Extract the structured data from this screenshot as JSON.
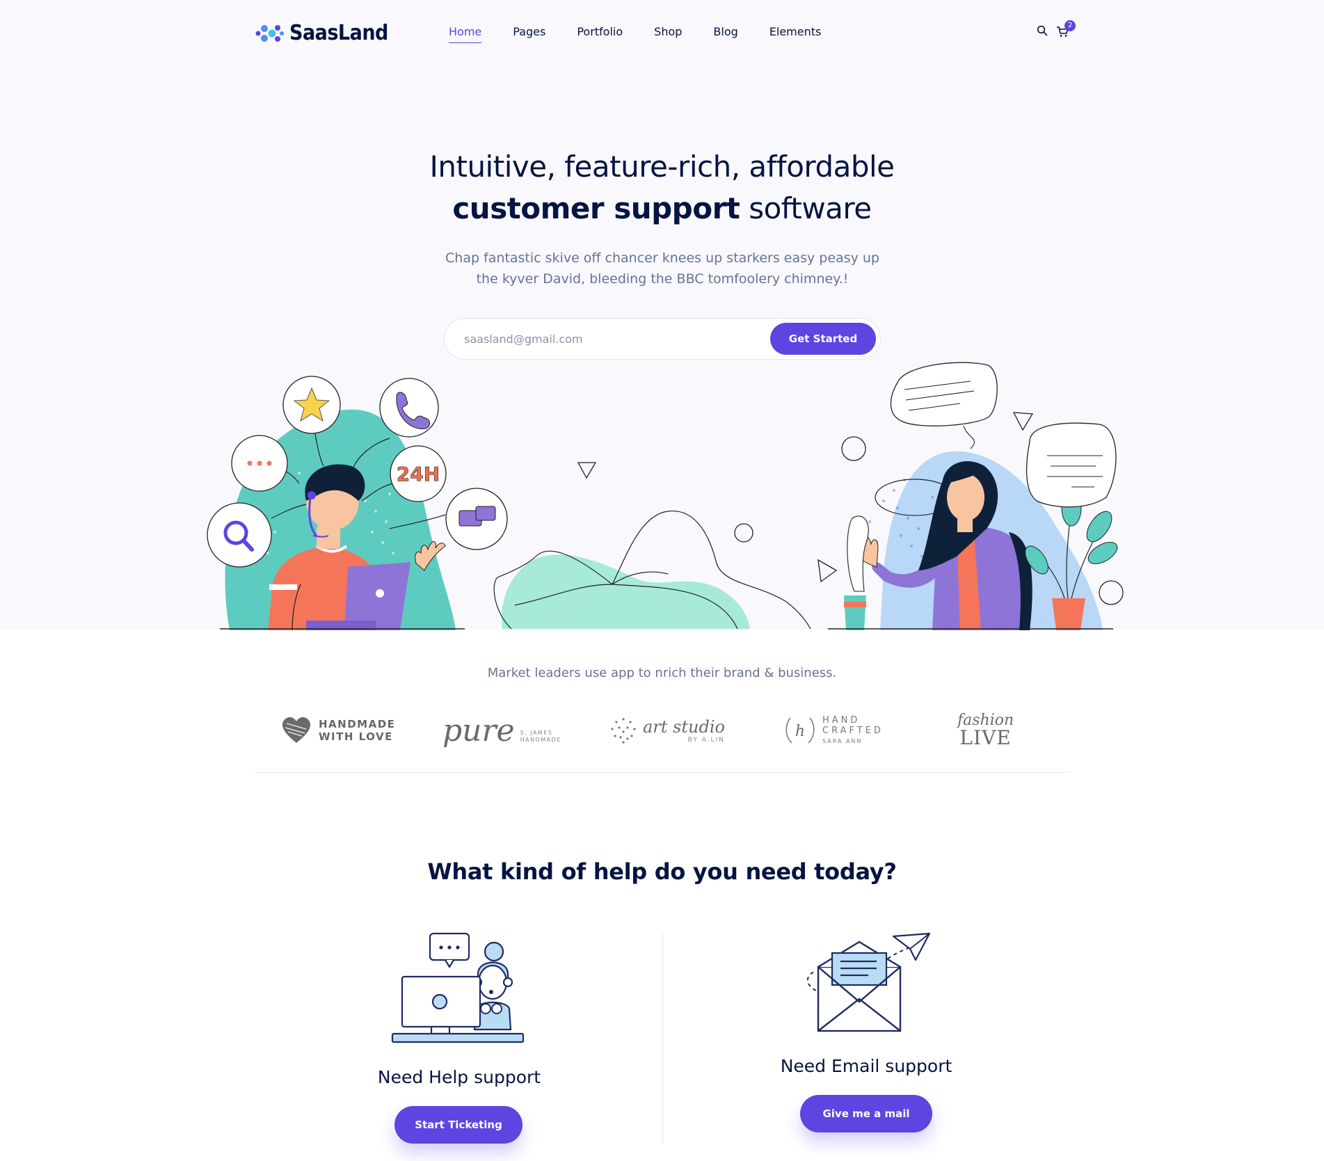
{
  "brand": {
    "name": "SaasLand"
  },
  "nav": {
    "items": [
      {
        "label": "Home",
        "active": true
      },
      {
        "label": "Pages"
      },
      {
        "label": "Portfolio"
      },
      {
        "label": "Shop"
      },
      {
        "label": "Blog"
      },
      {
        "label": "Elements"
      }
    ]
  },
  "header_icons": {
    "search": "search-icon",
    "cart": "cart-icon",
    "cart_count": "2"
  },
  "hero": {
    "title_line1": "Intuitive, feature-rich, affordable",
    "title_bold": "customer support",
    "title_rest": " software",
    "description": "Chap fantastic skive off chancer knees up starkers easy peasy up the kyver David, bleeding the BBC tomfoolery chimney.!",
    "email_placeholder": "saasland@gmail.com",
    "cta_label": "Get Started",
    "badge_24h": "24H"
  },
  "clients": {
    "tagline": "Market leaders use app to nrich their brand & business.",
    "logos": [
      {
        "line1": "HANDMADE",
        "line2": "WITH LOVE"
      },
      {
        "script": "pure",
        "sub1": "S. JAMES",
        "sub2": "HANDMADE"
      },
      {
        "script": "art studio",
        "sub1": "BY A.LIN"
      },
      {
        "line1": "HAND",
        "line2": "CRAFTED",
        "sub1": "SARA ANN",
        "mono": "h"
      },
      {
        "script": "fashion",
        "line1": "LIVE"
      }
    ]
  },
  "help": {
    "title": "What kind of help do you need today?",
    "cards": [
      {
        "title": "Need Help support",
        "button": "Start Ticketing"
      },
      {
        "title": "Need Email support",
        "button": "Give me a mail"
      }
    ]
  },
  "colors": {
    "accent": "#5e44e1",
    "heading": "#051441",
    "text": "#677294",
    "teal": "#5ecbc0",
    "coral": "#f26f4f"
  }
}
